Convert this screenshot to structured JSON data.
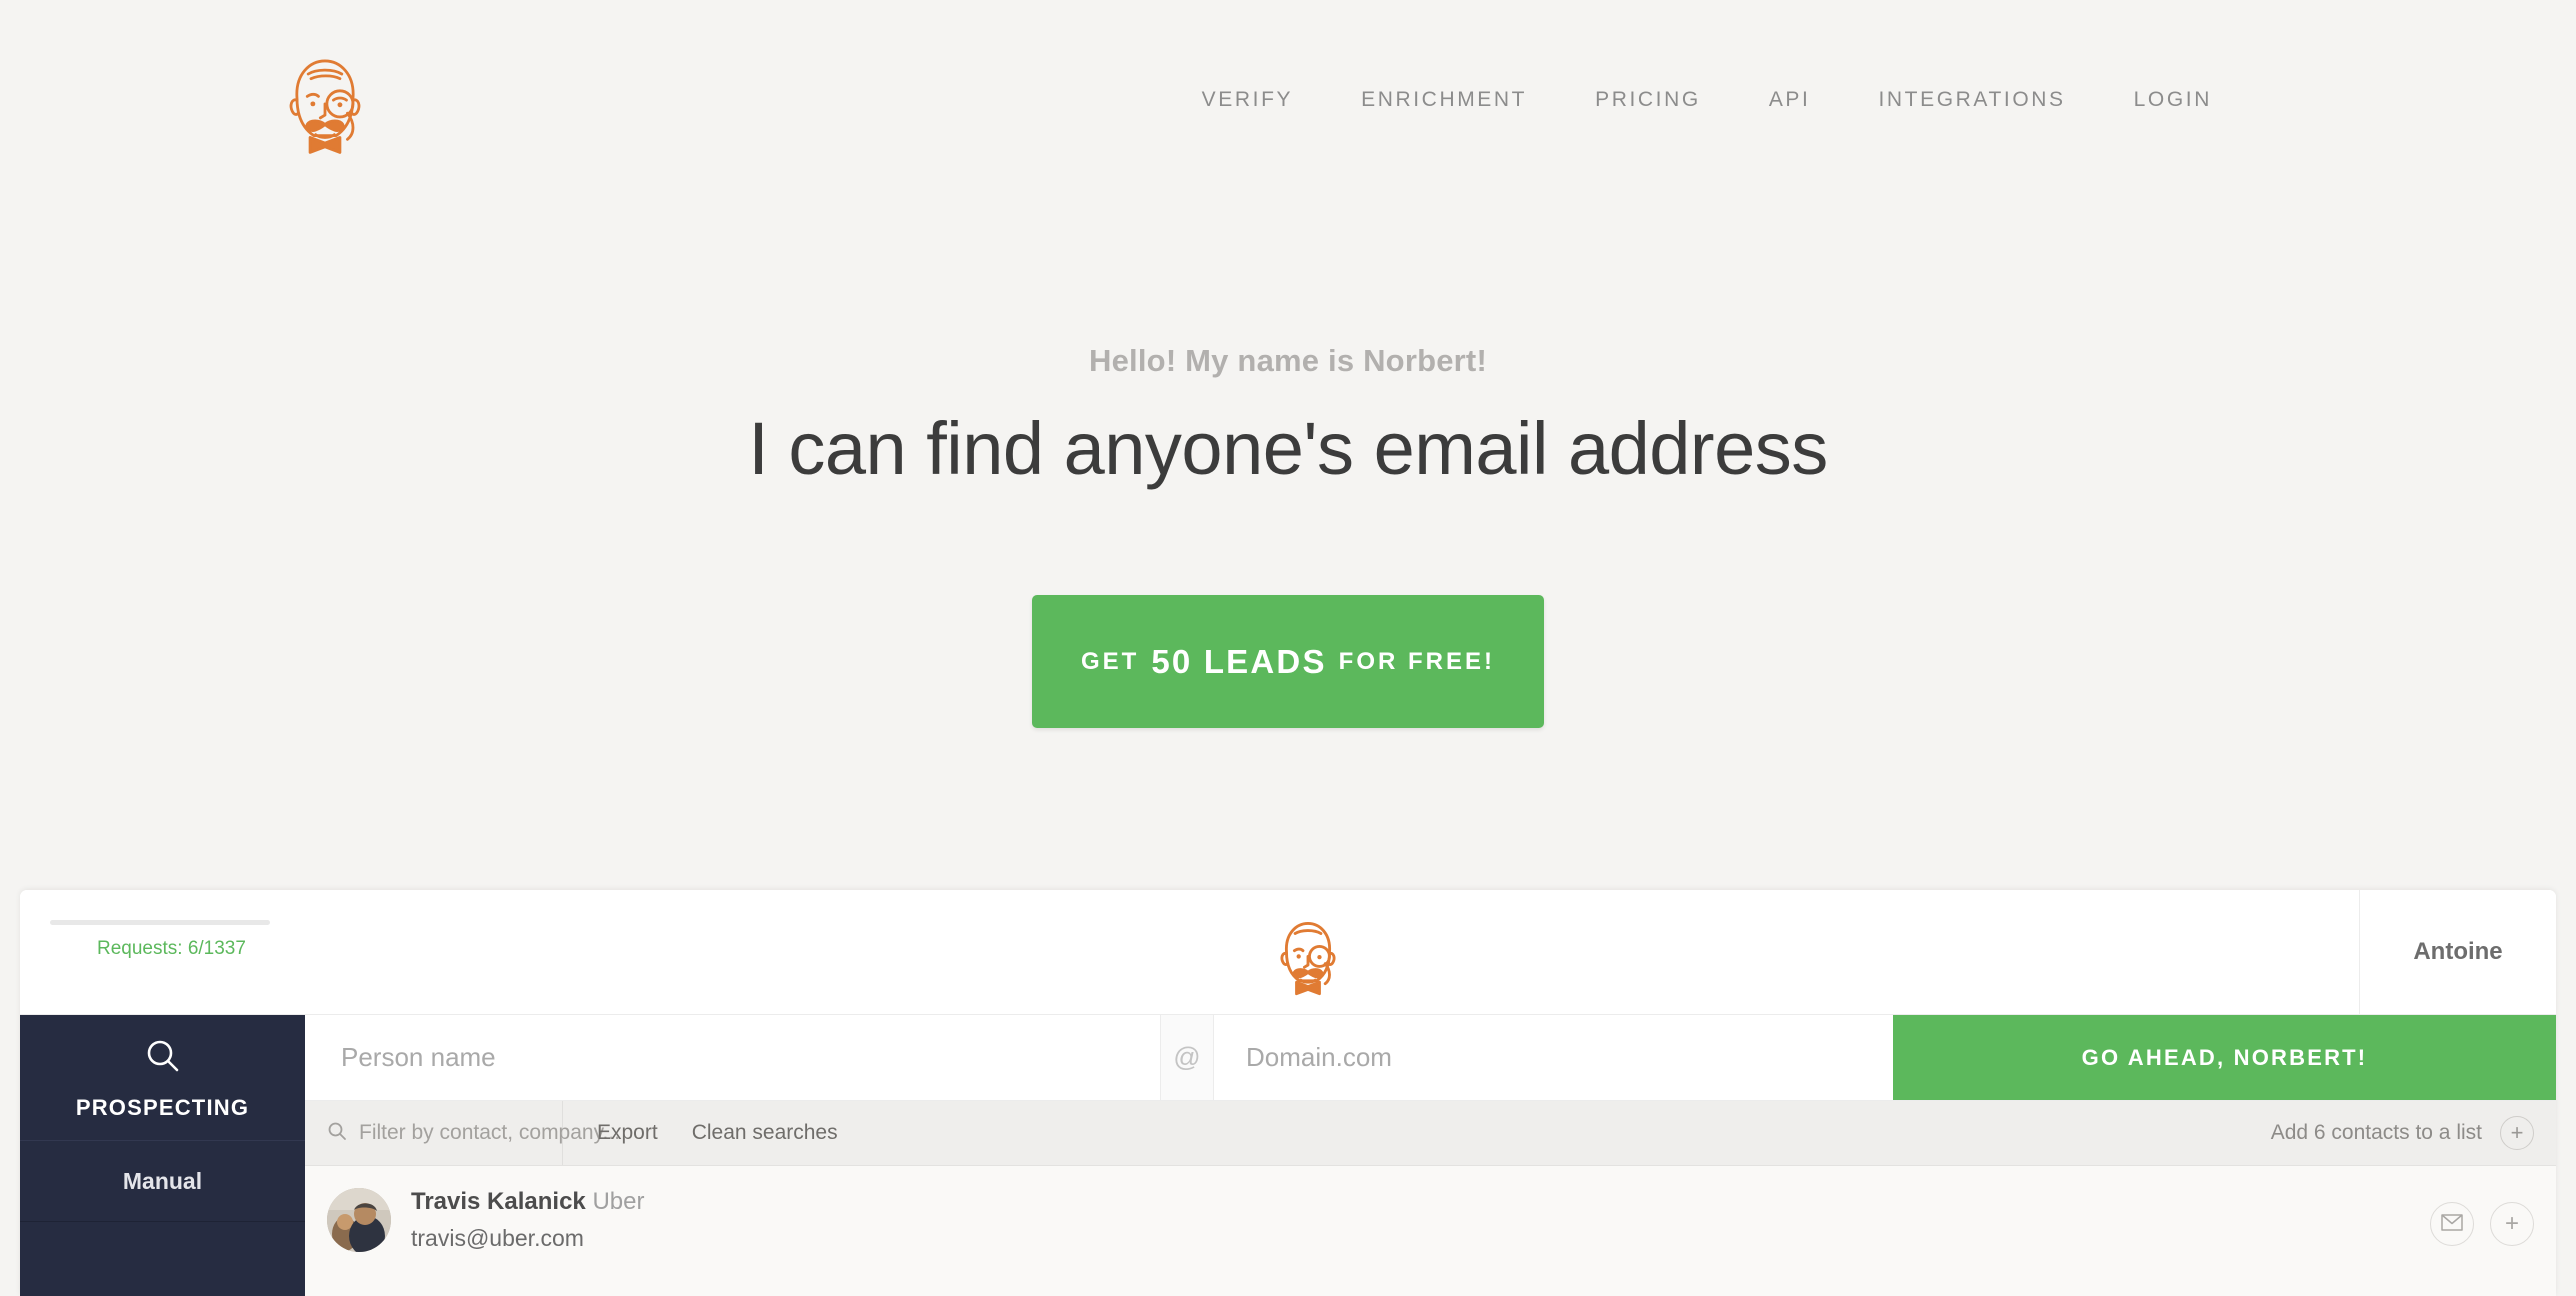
{
  "site": {
    "logo_icon": "norbert-face-logo-icon",
    "nav": [
      {
        "label": "VERIFY"
      },
      {
        "label": "ENRICHMENT"
      },
      {
        "label": "PRICING"
      },
      {
        "label": "API"
      },
      {
        "label": "INTEGRATIONS"
      },
      {
        "label": "LOGIN"
      }
    ]
  },
  "hero": {
    "eyebrow": "Hello! My name is Norbert!",
    "title": "I can find anyone's email address",
    "cta": {
      "prefix": "GET",
      "highlight": "50 LEADS",
      "suffix": "FOR FREE!"
    }
  },
  "app": {
    "topbar": {
      "quota_label": "Requests: 6/1337",
      "logo_icon": "norbert-face-logo-icon",
      "account_name": "Antoine"
    },
    "sidebar": {
      "head_icon": "magnifier-icon",
      "head_label": "PROSPECTING",
      "items": [
        {
          "label": "Manual"
        }
      ]
    },
    "search": {
      "person_placeholder": "Person name",
      "at_symbol": "@",
      "domain_placeholder": "Domain.com",
      "submit_label": "GO AHEAD, NORBERT!"
    },
    "toolbar": {
      "filter_icon": "search-icon",
      "filter_placeholder": "Filter by contact, company...",
      "export_label": "Export",
      "clean_label": "Clean searches",
      "add_list_label": "Add 6 contacts to a list",
      "add_list_icon": "plus-icon"
    },
    "contacts": [
      {
        "avatar": "contact-photo-avatar",
        "name": "Travis Kalanick",
        "company": "Uber",
        "email": "travis@uber.com",
        "mail_icon": "envelope-icon",
        "add_icon": "plus-icon"
      }
    ]
  },
  "colors": {
    "accent_green": "#5cb85c",
    "brand_orange": "#e07b33",
    "sidebar_navy": "#262c41",
    "page_bg": "#f5f4f2"
  }
}
